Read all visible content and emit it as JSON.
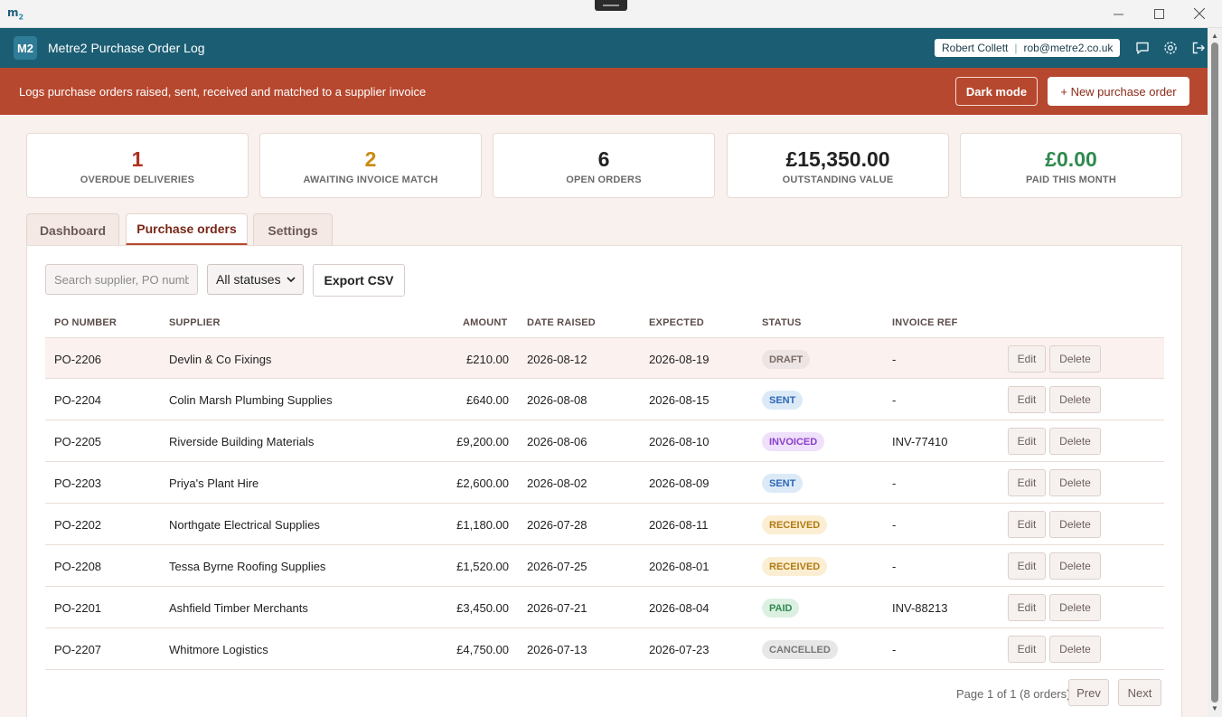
{
  "window": {
    "logo": "m2",
    "minimize_icon": "minimize-icon",
    "maximize_icon": "maximize-icon",
    "close_icon": "close-icon"
  },
  "header": {
    "logo": "M2",
    "title": "Metre2 Purchase Order Log",
    "user_name": "Robert Collett",
    "user_email": "rob@metre2.co.uk",
    "icons": [
      "chat-icon",
      "gear-icon",
      "logout-icon"
    ]
  },
  "banner": {
    "text": "Logs purchase orders raised, sent, received and matched to a supplier invoice",
    "dark_mode_label": "Dark mode",
    "new_po_label": "+ New purchase order",
    "color": "#b6482f"
  },
  "stats": [
    {
      "value": "1",
      "label": "OVERDUE DELIVERIES",
      "color": "#b0301f"
    },
    {
      "value": "2",
      "label": "AWAITING INVOICE MATCH",
      "color": "#c98a12"
    },
    {
      "value": "6",
      "label": "OPEN ORDERS",
      "color": "#222222"
    },
    {
      "value": "£15,350.00",
      "label": "OUTSTANDING VALUE",
      "color": "#222222"
    },
    {
      "value": "£0.00",
      "label": "PAID THIS MONTH",
      "color": "#2f8a4e"
    }
  ],
  "tabs": [
    {
      "label": "Dashboard",
      "active": false
    },
    {
      "label": "Purchase orders",
      "active": true
    },
    {
      "label": "Settings",
      "active": false
    }
  ],
  "toolbar": {
    "search_placeholder": "Search supplier, PO number",
    "status_selected": "All statuses",
    "export_label": "Export CSV"
  },
  "table": {
    "headers": [
      "PO NUMBER",
      "SUPPLIER",
      "AMOUNT",
      "DATE RAISED",
      "EXPECTED",
      "STATUS",
      "INVOICE REF"
    ],
    "edit_label": "Edit",
    "delete_label": "Delete",
    "rows": [
      {
        "po": "PO-2206",
        "supplier": "Devlin & Co Fixings",
        "amount": "£210.00",
        "raised": "2026-08-12",
        "expected": "2026-08-19",
        "status": "DRAFT",
        "status_key": "draft",
        "invoice": "-"
      },
      {
        "po": "PO-2204",
        "supplier": "Colin Marsh Plumbing Supplies",
        "amount": "£640.00",
        "raised": "2026-08-08",
        "expected": "2026-08-15",
        "status": "SENT",
        "status_key": "sent",
        "invoice": "-"
      },
      {
        "po": "PO-2205",
        "supplier": "Riverside Building Materials",
        "amount": "£9,200.00",
        "raised": "2026-08-06",
        "expected": "2026-08-10",
        "status": "INVOICED",
        "status_key": "invoiced",
        "invoice": "INV-77410"
      },
      {
        "po": "PO-2203",
        "supplier": "Priya's Plant Hire",
        "amount": "£2,600.00",
        "raised": "2026-08-02",
        "expected": "2026-08-09",
        "status": "SENT",
        "status_key": "sent",
        "invoice": "-"
      },
      {
        "po": "PO-2202",
        "supplier": "Northgate Electrical Supplies",
        "amount": "£1,180.00",
        "raised": "2026-07-28",
        "expected": "2026-08-11",
        "status": "RECEIVED",
        "status_key": "received",
        "invoice": "-"
      },
      {
        "po": "PO-2208",
        "supplier": "Tessa Byrne Roofing Supplies",
        "amount": "£1,520.00",
        "raised": "2026-07-25",
        "expected": "2026-08-01",
        "status": "RECEIVED",
        "status_key": "received",
        "invoice": "-"
      },
      {
        "po": "PO-2201",
        "supplier": "Ashfield Timber Merchants",
        "amount": "£3,450.00",
        "raised": "2026-07-21",
        "expected": "2026-08-04",
        "status": "PAID",
        "status_key": "paid",
        "invoice": "INV-88213"
      },
      {
        "po": "PO-2207",
        "supplier": "Whitmore Logistics",
        "amount": "£4,750.00",
        "raised": "2026-07-13",
        "expected": "2026-07-23",
        "status": "CANCELLED",
        "status_key": "cancelled",
        "invoice": "-"
      }
    ]
  },
  "pager": {
    "text": "Page 1 of 1 (8 orders)",
    "prev_label": "Prev",
    "next_label": "Next"
  }
}
